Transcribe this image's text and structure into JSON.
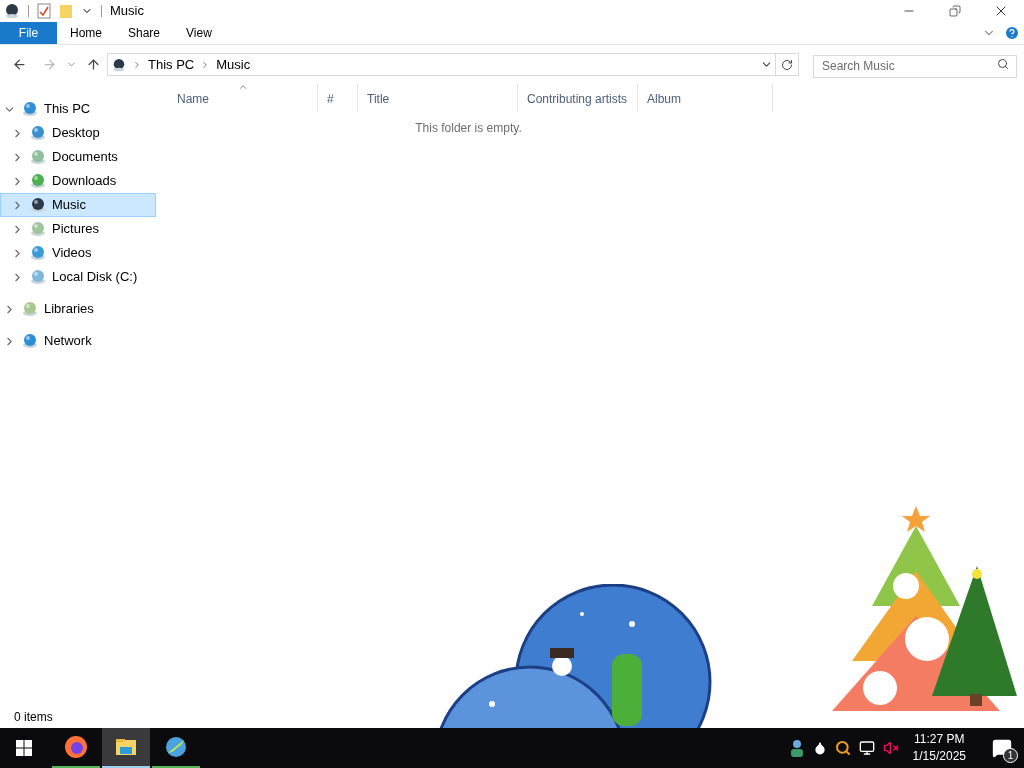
{
  "window": {
    "title": "Music"
  },
  "ribbon_tabs": [
    {
      "label": "File",
      "kind": "file"
    },
    {
      "label": "Home",
      "kind": "tab"
    },
    {
      "label": "Share",
      "kind": "tab"
    },
    {
      "label": "View",
      "kind": "tab"
    }
  ],
  "address": {
    "path": [
      "This PC",
      "Music"
    ]
  },
  "search": {
    "placeholder": "Search Music"
  },
  "nav_tree": [
    {
      "label": "This PC",
      "expanded": true,
      "selected": false,
      "children": [
        {
          "label": "Desktop",
          "expanded": false,
          "selected": false
        },
        {
          "label": "Documents",
          "expanded": false,
          "selected": false
        },
        {
          "label": "Downloads",
          "expanded": false,
          "selected": false
        },
        {
          "label": "Music",
          "expanded": false,
          "selected": true
        },
        {
          "label": "Pictures",
          "expanded": false,
          "selected": false
        },
        {
          "label": "Videos",
          "expanded": false,
          "selected": false
        },
        {
          "label": "Local Disk (C:)",
          "expanded": false,
          "selected": false
        }
      ]
    },
    {
      "label": "Libraries",
      "expanded": false,
      "selected": false
    },
    {
      "label": "Network",
      "expanded": false,
      "selected": false
    }
  ],
  "columns": [
    {
      "label": "Name",
      "sorted": true
    },
    {
      "label": "#",
      "sorted": false
    },
    {
      "label": "Title",
      "sorted": false
    },
    {
      "label": "Contributing artists",
      "sorted": false
    },
    {
      "label": "Album",
      "sorted": false
    }
  ],
  "empty_message": "This folder is empty.",
  "status_bar": {
    "item_count": "0 items"
  },
  "taskbar": {
    "apps": [
      {
        "kind": "firefox",
        "active": false
      },
      {
        "kind": "explorer",
        "active": true
      },
      {
        "kind": "globe",
        "active": false
      }
    ],
    "clock": {
      "time": "11:27 PM",
      "date": "1/15/2025"
    },
    "notification_count": "1"
  }
}
